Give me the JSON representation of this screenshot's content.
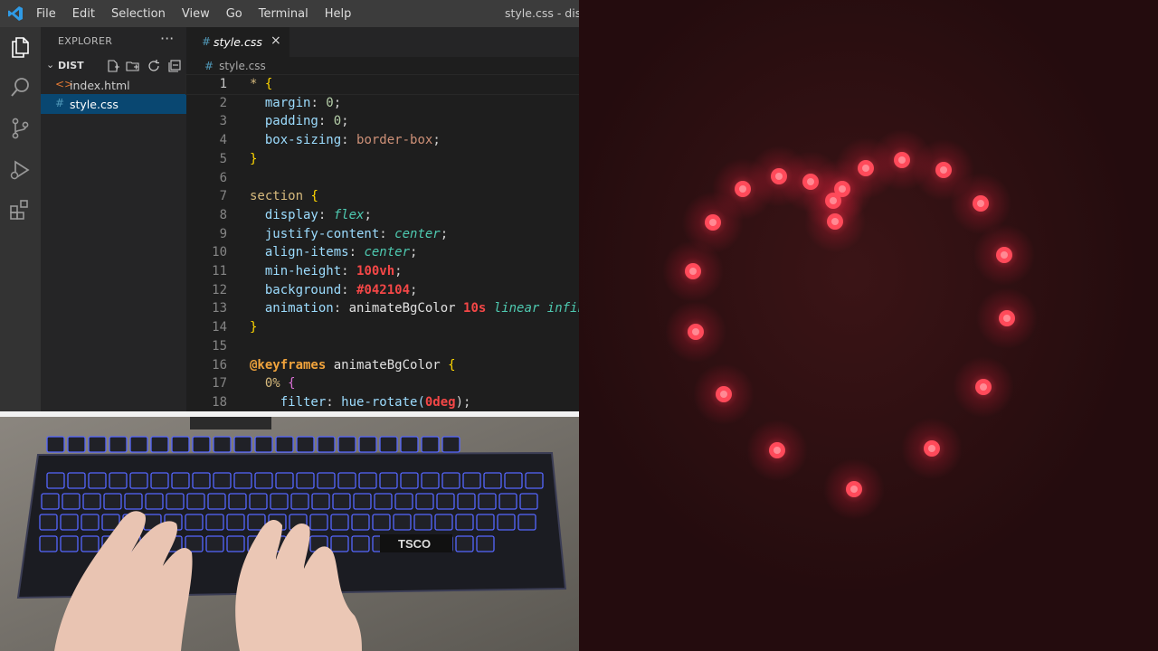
{
  "window": {
    "title": "style.css - dist - V",
    "menu": [
      "File",
      "Edit",
      "Selection",
      "View",
      "Go",
      "Terminal",
      "Help"
    ]
  },
  "activity_bar": [
    "explorer-icon",
    "search-icon",
    "source-control-icon",
    "run-debug-icon",
    "extensions-icon"
  ],
  "sidebar": {
    "header": "EXPLORER",
    "more": "···",
    "folder": "DIST",
    "files": [
      {
        "name": "index.html",
        "icon": "<>",
        "selected": false
      },
      {
        "name": "style.css",
        "icon": "#",
        "selected": true
      }
    ]
  },
  "editor": {
    "tab_label": "style.css",
    "tab_close": "×",
    "breadcrumb": "style.css",
    "current_line": 1,
    "lines": [
      "1",
      "2",
      "3",
      "4",
      "5",
      "6",
      "7",
      "8",
      "9",
      "10",
      "11",
      "12",
      "13",
      "14",
      "15",
      "16",
      "17",
      "18"
    ]
  },
  "code": {
    "l1_sel": "* ",
    "l1_brace": "{",
    "l2_prop": "margin",
    "l2_val": "0",
    "l3_prop": "padding",
    "l3_val": "0",
    "l4_prop": "box-sizing",
    "l4_val": "border-box",
    "l5_brace": "}",
    "l7_sel": "section ",
    "l7_brace": "{",
    "l8_prop": "display",
    "l8_val": "flex",
    "l9_prop": "justify-content",
    "l9_val": "center",
    "l10_prop": "align-items",
    "l10_val": "center",
    "l11_prop": "min-height",
    "l11_val": "100vh",
    "l12_prop": "background",
    "l12_val": "#042104",
    "l13_prop": "animation",
    "l13_name": "animateBgColor",
    "l13_dur": "10s",
    "l13_rest": "linear infin",
    "l14_brace": "}",
    "l16_kw": "@keyframes",
    "l16_name": " animateBgColor ",
    "l16_brace": "{",
    "l17_pct": "0%",
    "l17_brace": "{",
    "l18_prop": "filter",
    "l18_fn": "hue-rotate(",
    "l18_val": "0deg",
    "l18_end": ");"
  },
  "keyboard_photo": {
    "brand": "TSCO"
  },
  "colors": {
    "preview_bg": "#2a0f11",
    "dot": "#ff4a5a",
    "glow": "#ff2040"
  }
}
